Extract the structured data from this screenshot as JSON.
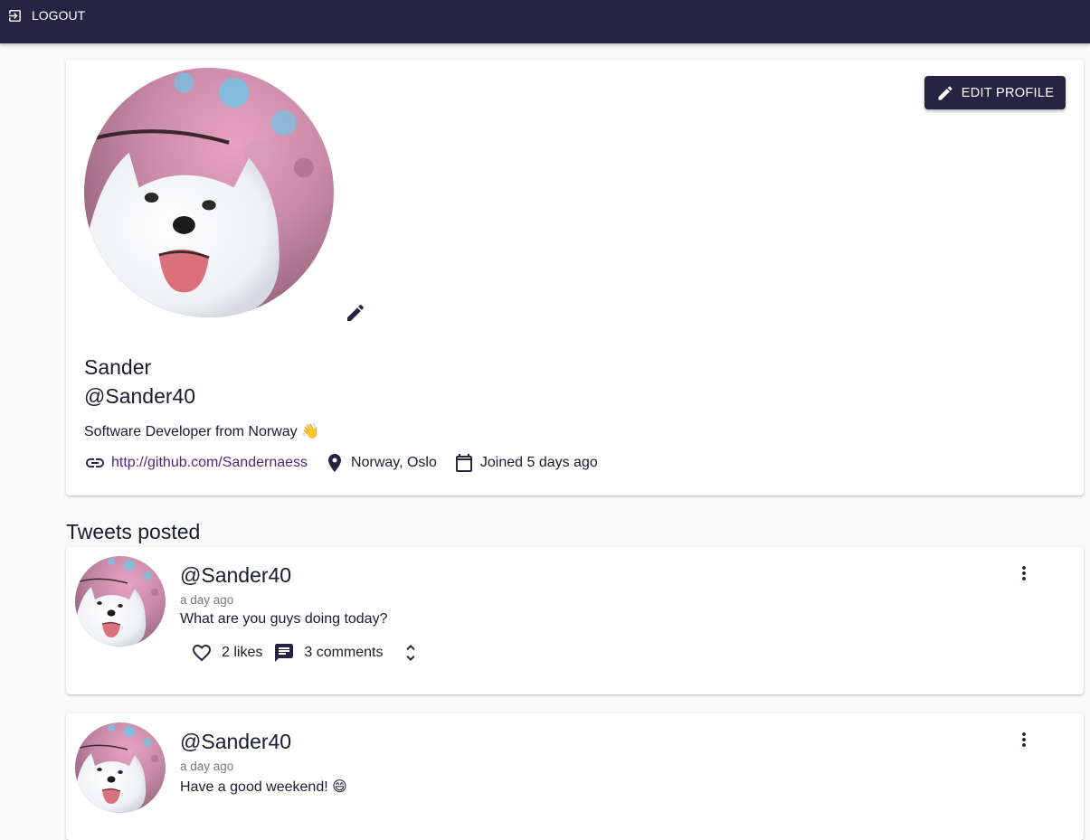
{
  "appbar": {
    "logout_label": "LOGOUT"
  },
  "profile": {
    "edit_button_label": "EDIT PROFILE",
    "name": "Sander",
    "handle": "@Sander40",
    "bio_text": "Software Developer from Norway",
    "bio_emoji": "👋",
    "website": "http://github.com/Sandernaess",
    "location": "Norway, Oslo",
    "joined": "Joined 5 days ago"
  },
  "section_title": "Tweets posted",
  "tweets": [
    {
      "handle": "@Sander40",
      "time": "a day ago",
      "text": "What are you guys doing today?",
      "emoji": "",
      "likes": "2 likes",
      "comments": "3 comments"
    },
    {
      "handle": "@Sander40",
      "time": "a day ago",
      "text": "Have a good weekend!",
      "emoji": "😄",
      "likes": "",
      "comments": ""
    }
  ],
  "colors": {
    "primary": "#272343",
    "link": "#4a2a7a",
    "background": "#fafafa"
  },
  "icons": [
    "logout-icon",
    "edit-icon",
    "pencil-icon",
    "link-icon",
    "location-icon",
    "calendar-icon",
    "heart-icon",
    "comment-icon",
    "expand-icon",
    "more-vert-icon"
  ]
}
